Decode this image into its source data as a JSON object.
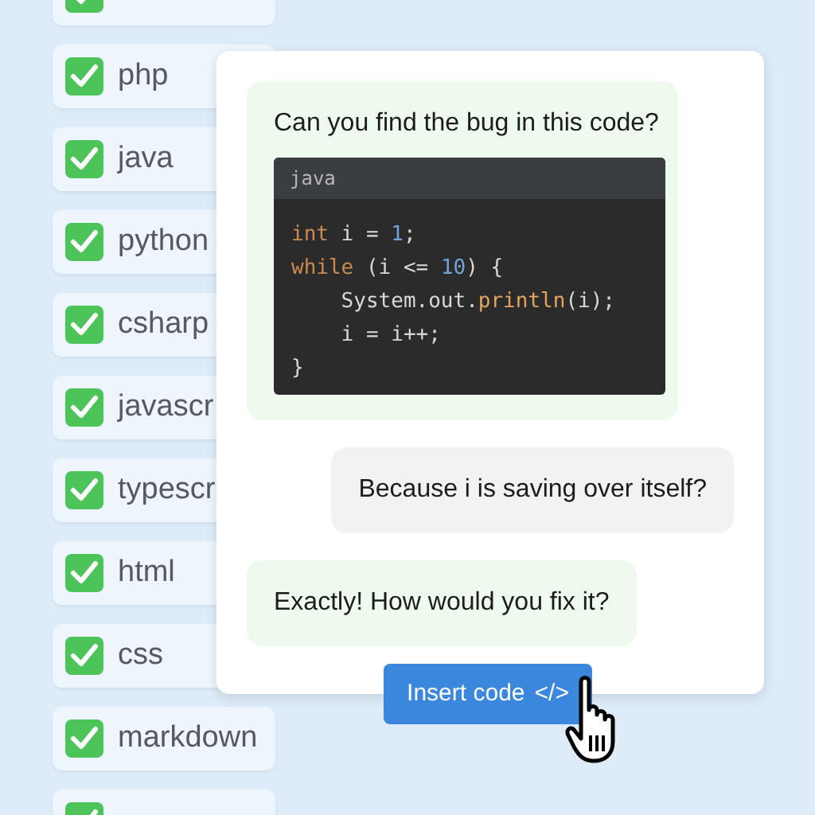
{
  "languages": [
    {
      "checked": true
    },
    {
      "label": "php",
      "checked": true
    },
    {
      "label": "java",
      "checked": true
    },
    {
      "label": "python",
      "checked": true
    },
    {
      "label": "csharp",
      "checked": true
    },
    {
      "label": "javascr",
      "checked": true
    },
    {
      "label": "typescr",
      "checked": true
    },
    {
      "label": "html",
      "checked": true
    },
    {
      "label": "css",
      "checked": true
    },
    {
      "label": "markdown",
      "checked": true
    },
    {
      "checked": true
    }
  ],
  "chat": {
    "messages": [
      {
        "kind": "received",
        "text": "Can you find the bug in this code?",
        "code": {
          "language": "java",
          "lines": [
            [
              {
                "kind": "keyword",
                "text": "int"
              },
              {
                "kind": "plain",
                "text": " i = "
              },
              {
                "kind": "number",
                "text": "1"
              },
              {
                "kind": "plain",
                "text": ";"
              }
            ],
            [
              {
                "kind": "keyword",
                "text": "while"
              },
              {
                "kind": "plain",
                "text": " (i <= "
              },
              {
                "kind": "number",
                "text": "10"
              },
              {
                "kind": "plain",
                "text": ") {"
              }
            ],
            [
              {
                "kind": "plain",
                "text": "    System.out."
              },
              {
                "kind": "method",
                "text": "println"
              },
              {
                "kind": "plain",
                "text": "(i);"
              }
            ],
            [
              {
                "kind": "plain",
                "text": "    i = i++;"
              }
            ],
            [
              {
                "kind": "plain",
                "text": "}"
              }
            ]
          ]
        }
      },
      {
        "kind": "sent",
        "text": "Because i is saving over itself?"
      },
      {
        "kind": "received",
        "text": "Exactly! How would you fix it?"
      }
    ]
  },
  "insert_button": {
    "label": "Insert code",
    "icon": "</>"
  }
}
